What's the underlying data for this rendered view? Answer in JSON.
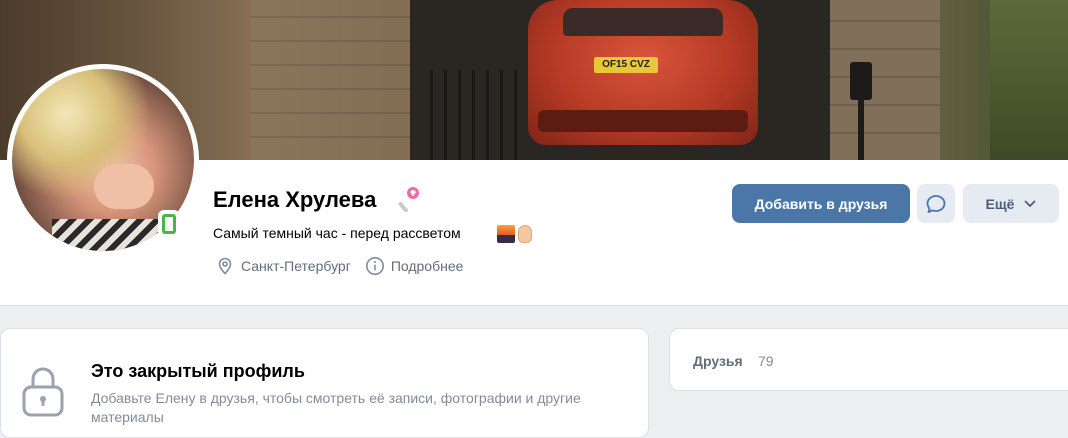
{
  "cover": {
    "plate_text": "OF15 CVZ"
  },
  "profile": {
    "name": "Елена Хрулева",
    "status": "Самый темный час - перед рассветом",
    "city": "Санкт-Петербург",
    "more_info": "Подробнее",
    "online_indicator": "mobile"
  },
  "actions": {
    "add_friend": "Добавить в друзья",
    "more": "Ещё"
  },
  "private": {
    "title": "Это закрытый профиль",
    "text": "Добавьте Елену в друзья, чтобы смотреть её записи, фотографии и другие материалы"
  },
  "friends": {
    "label": "Друзья",
    "count": "79"
  },
  "colors": {
    "primary_button": "#4a76a8",
    "secondary_button": "#e5ebf1",
    "online_green": "#4bb34b",
    "page_bg": "#edeef0"
  }
}
